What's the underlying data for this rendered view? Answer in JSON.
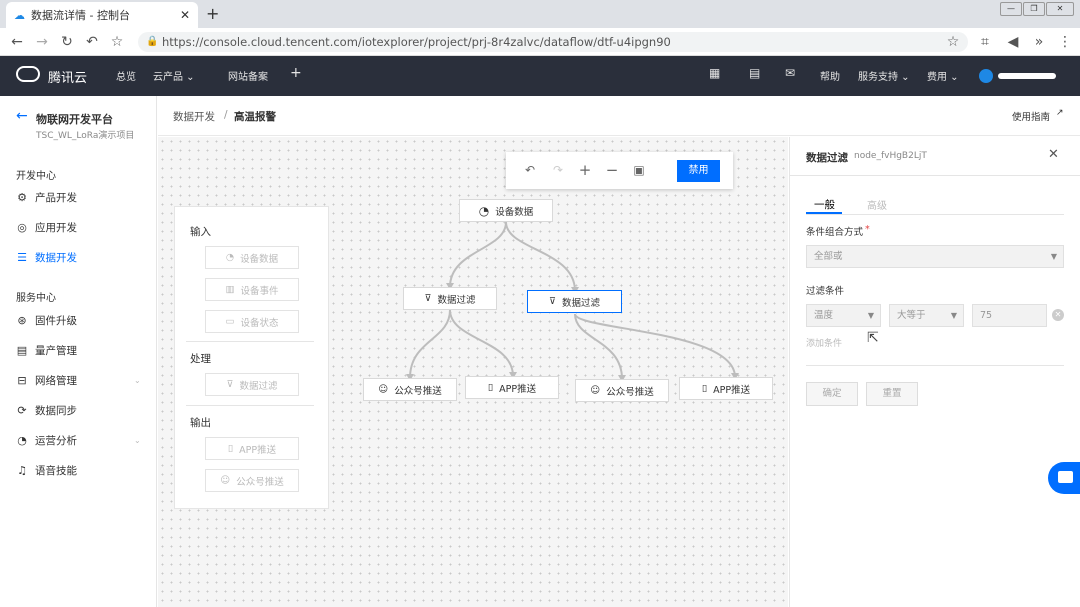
{
  "browser": {
    "tab_title": "数据流详情 - 控制台",
    "url": "https://console.cloud.tencent.com/iotexplorer/project/prj-8r4zalvc/dataflow/dtf-u4ipgn90"
  },
  "topnav": {
    "brand": "腾讯云",
    "items": [
      "总览",
      "云产品 ⌄",
      "网站备案",
      "+"
    ],
    "right_items": [
      "帮助",
      "服务支持 ⌄",
      "费用 ⌄"
    ]
  },
  "sidebar": {
    "title": "物联网开发平台",
    "subtitle": "TSC_WL_LoRa演示项目",
    "groups": [
      {
        "label": "开发中心",
        "items": [
          "产品开发",
          "应用开发",
          "数据开发"
        ]
      },
      {
        "label": "服务中心",
        "items": [
          "固件升级",
          "量产管理",
          "网络管理",
          "数据同步",
          "运营分析",
          "语音技能"
        ]
      }
    ]
  },
  "breadcrumb": {
    "parent": "数据开发",
    "separator": "/",
    "current": "高温报警",
    "guide": "使用指南"
  },
  "toolbar": {
    "disable_label": "禁用"
  },
  "palette": {
    "input_label": "输入",
    "input_items": [
      "设备数据",
      "设备事件",
      "设备状态"
    ],
    "process_label": "处理",
    "process_items": [
      "数据过滤"
    ],
    "output_label": "输出",
    "output_items": [
      "APP推送",
      "公众号推送"
    ]
  },
  "flow": {
    "root": "设备数据",
    "filter_a": "数据过滤",
    "filter_b": "数据过滤",
    "out_a1": "公众号推送",
    "out_a2": "APP推送",
    "out_b1": "公众号推送",
    "out_b2": "APP推送"
  },
  "panel": {
    "title": "数据过滤",
    "node_id": "node_fvHgB2LjT",
    "tabs": [
      "一般",
      "高级"
    ],
    "combine_label": "条件组合方式",
    "required_mark": "*",
    "combine_value": "全部或",
    "filter_label": "过滤条件",
    "cond_field": "温度",
    "cond_op": "大等于",
    "cond_value": "75",
    "add_condition": "添加条件",
    "confirm": "确定",
    "reset": "重置"
  },
  "colors": {
    "accent": "#006eff",
    "topbar": "#2a2f3b"
  }
}
